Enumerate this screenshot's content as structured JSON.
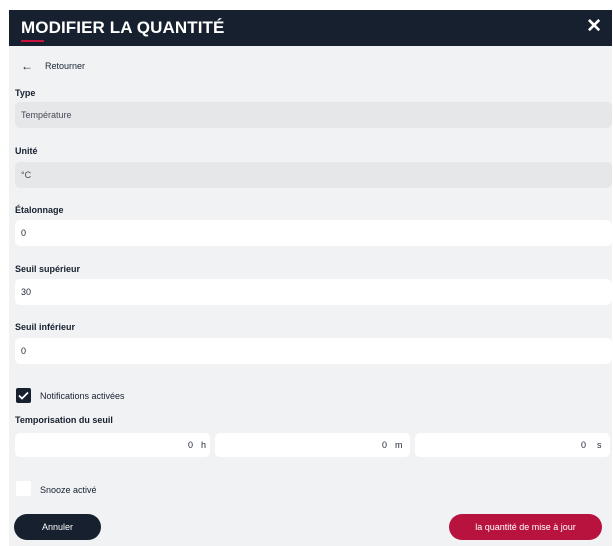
{
  "modal": {
    "title": "MODIFIER LA QUANTITÉ",
    "close_symbol": "✕",
    "back_label": "Retourner"
  },
  "fields": {
    "type": {
      "label": "Type",
      "value": "Température"
    },
    "unit": {
      "label": "Unité",
      "value": "°C"
    },
    "calibration": {
      "label": "Étalonnage",
      "value": "0"
    },
    "upper_threshold": {
      "label": "Seuil supérieur",
      "value": "30"
    },
    "lower_threshold": {
      "label": "Seuil inférieur",
      "value": "0"
    }
  },
  "notifications": {
    "label": "Notifications activées",
    "checked": true
  },
  "delay": {
    "label": "Temporisation du seuil",
    "hours": {
      "value": "0",
      "unit": "h"
    },
    "minutes": {
      "value": "0",
      "unit": "m"
    },
    "seconds": {
      "value": "0",
      "unit": "s"
    }
  },
  "snooze": {
    "label": "Snooze activé",
    "checked": false
  },
  "buttons": {
    "cancel": "Annuler",
    "update": "la quantité de mise à jour"
  },
  "colors": {
    "header": "#17202f",
    "accent": "#c8143c",
    "update_button": "#b8123f",
    "background": "#f1f2f4"
  }
}
